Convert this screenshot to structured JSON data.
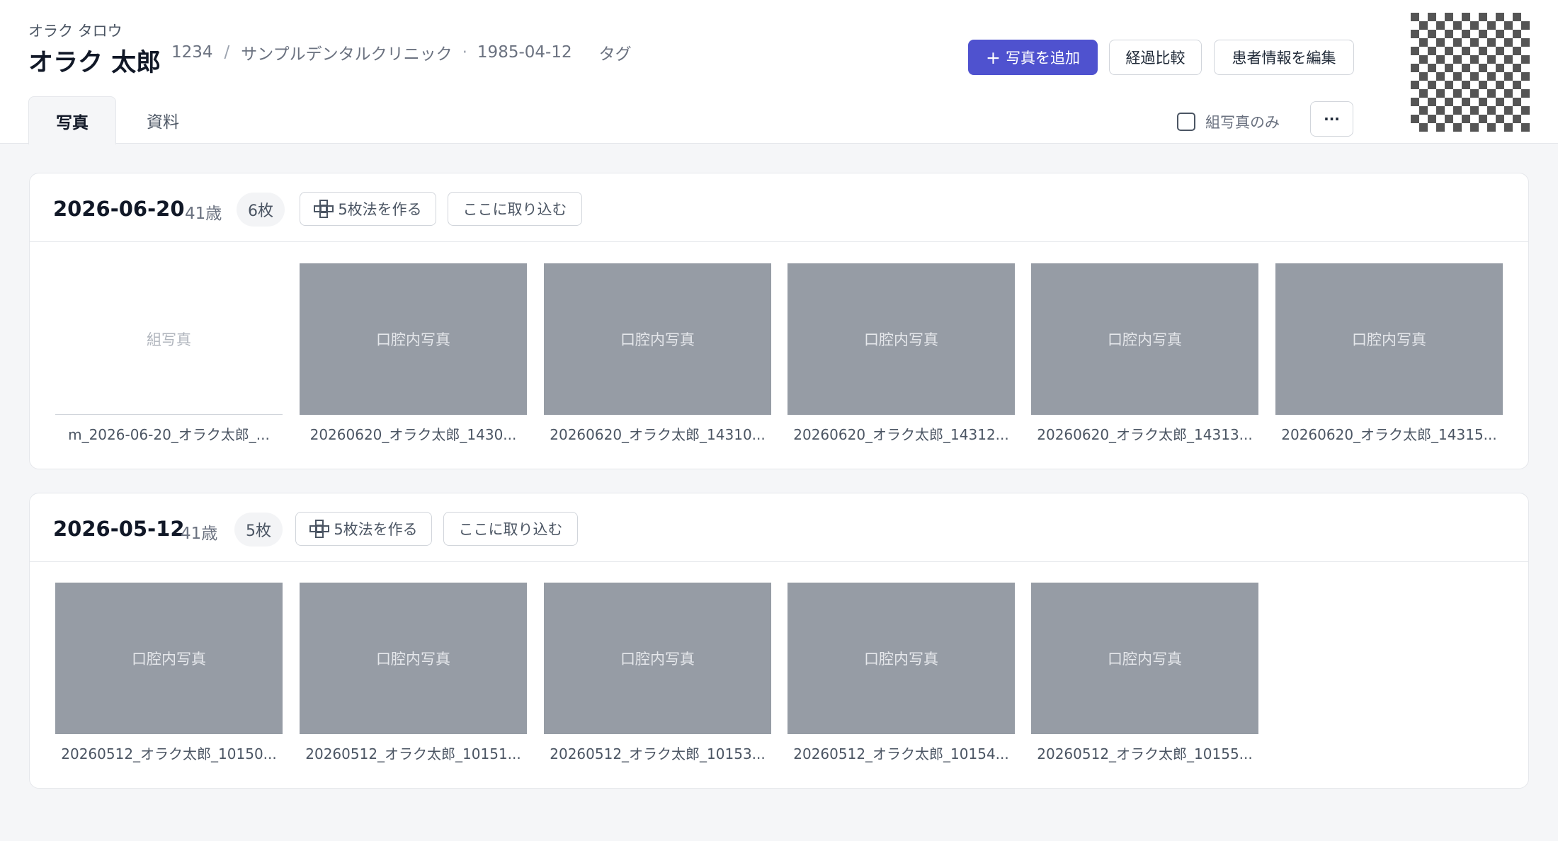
{
  "patient": {
    "kana": "オラク タロウ",
    "name": "オラク 太郎",
    "id": "1234",
    "separator": "/",
    "clinic": "サンプルデンタルクリニック",
    "dot": "·",
    "birthdate": "1985-04-12",
    "tag_label": "タグ"
  },
  "actions": {
    "add_photo": "写真を追加",
    "add_photo_plus": "+",
    "compare": "経過比較",
    "edit_patient": "患者情報を編集"
  },
  "tabs": [
    {
      "label": "写真",
      "active": true
    },
    {
      "label": "資料",
      "active": false
    }
  ],
  "filter": {
    "combo_only_label": "組写真のみ",
    "checked": false
  },
  "more_label": "···",
  "sessions": [
    {
      "date": "2026-06-20",
      "age": "41歳",
      "count": "6枚",
      "make_five": "5枚法を作る",
      "import_here": "ここに取り込む",
      "photos": [
        {
          "kind": "combo",
          "label": "組写真",
          "filename": "m_2026-06-20_オラク太郎_..."
        },
        {
          "kind": "intraoral",
          "label": "口腔内写真",
          "filename": "20260620_オラク太郎_1430..."
        },
        {
          "kind": "intraoral",
          "label": "口腔内写真",
          "filename": "20260620_オラク太郎_14310..."
        },
        {
          "kind": "intraoral",
          "label": "口腔内写真",
          "filename": "20260620_オラク太郎_14312..."
        },
        {
          "kind": "intraoral",
          "label": "口腔内写真",
          "filename": "20260620_オラク太郎_14313..."
        },
        {
          "kind": "intraoral",
          "label": "口腔内写真",
          "filename": "20260620_オラク太郎_14315..."
        }
      ]
    },
    {
      "date": "2026-05-12",
      "age": "41歳",
      "count": "5枚",
      "make_five": "5枚法を作る",
      "import_here": "ここに取り込む",
      "photos": [
        {
          "kind": "intraoral",
          "label": "口腔内写真",
          "filename": "20260512_オラク太郎_10150..."
        },
        {
          "kind": "intraoral",
          "label": "口腔内写真",
          "filename": "20260512_オラク太郎_10151..."
        },
        {
          "kind": "intraoral",
          "label": "口腔内写真",
          "filename": "20260512_オラク太郎_10153..."
        },
        {
          "kind": "intraoral",
          "label": "口腔内写真",
          "filename": "20260512_オラク太郎_10154..."
        },
        {
          "kind": "intraoral",
          "label": "口腔内写真",
          "filename": "20260512_オラク太郎_10155..."
        }
      ]
    }
  ],
  "colors": {
    "accent": "#4f52cf",
    "thumb": "#969ca5",
    "background": "#f5f6f8"
  },
  "icons": {
    "qr": "qr-code-icon",
    "five_grid": "five-grid-icon",
    "checkbox": "checkbox-icon"
  }
}
